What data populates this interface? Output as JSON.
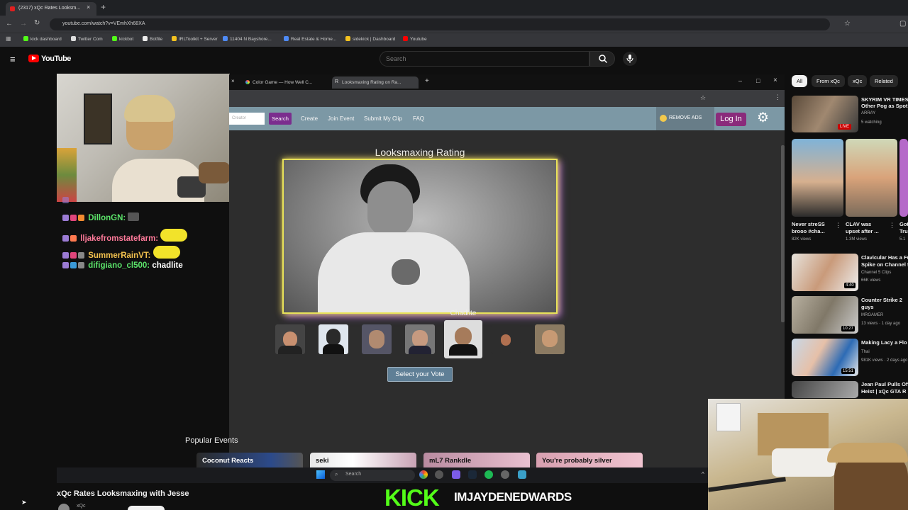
{
  "browser": {
    "tab_title": "(2317) xQc Rates Looksm...",
    "url": "youtube.com/watch?v=VEmhXh68XA",
    "bookmarks": [
      "kick dashboard",
      "Twitter Com",
      "kickbot",
      "Botfile",
      "IRLToolkit + Server",
      "11404 N Bayshore...",
      "Real Estate & Home...",
      "sidekick | Dashboard",
      "Youtube"
    ]
  },
  "youtube": {
    "logo": "YouTube",
    "search_placeholder": "Search",
    "video_title": "xQc Rates Looksmaxing with Jesse",
    "channel": "xQc"
  },
  "chat": [
    {
      "user": "DillonGN:",
      "msg": "",
      "color": "#5be36a"
    },
    {
      "user": "lljakefromstatefarm:",
      "msg": "",
      "color": "#ff7a9a"
    },
    {
      "user": "SummerRainVT:",
      "msg": "",
      "color": "#f2c14e"
    },
    {
      "user": "difigiano_cl500:",
      "msg": "chadlite",
      "color": "#5be36a"
    }
  ],
  "inner_browser": {
    "tabs": [
      "Color Game — How Well C...",
      "Looksmaxing Rating on Ra..."
    ]
  },
  "site": {
    "search_placeholder": "Creator",
    "search_button": "Search",
    "nav": [
      "Create",
      "Join Event",
      "Submit My Clip",
      "FAQ"
    ],
    "remove_ads": "REMOVE ADS",
    "login": "Log In",
    "rating_title": "Looksmaxing Rating",
    "photo_caption": "Chadlite",
    "vote_button": "Select your Vote",
    "popular_title": "Popular Events",
    "events": [
      "Coconut Reacts",
      "seki",
      "mL7 Rankdle",
      "You're probably silver"
    ]
  },
  "taskbar": {
    "search": "Search"
  },
  "chips": [
    "All",
    "From xQc",
    "xQc",
    "Related"
  ],
  "related": [
    {
      "title": "SKYRIM VR TIMES",
      "title2": "Other Pog as Spot",
      "channel": "ARRAY",
      "meta": "5 watching",
      "badge": "LIVE"
    },
    {
      "title": "Clavicular Has a Fu",
      "title2": "Spike on Channel 5",
      "channel": "Channel 5 Clips",
      "meta": "66K views",
      "badge": "4:40"
    },
    {
      "title": "Counter Strike 2",
      "title2": "guys",
      "channel": "MRGAMER",
      "meta": "13 views · 1 day ago",
      "badge": "10:27"
    },
    {
      "title": "Making Lacy a Flo",
      "title2": "",
      "channel": "Thai",
      "meta": "981K views · 2 days ago",
      "badge": "15:51"
    },
    {
      "title": "Jean Paul Pulls Off",
      "title2": "Heist | xQc GTA R",
      "channel": "",
      "meta": "",
      "badge": ""
    }
  ],
  "shorts": [
    {
      "title": "Never streSS",
      "title2": "brooo #cha...",
      "meta": "82K views"
    },
    {
      "title": "CLAV was",
      "title2": "upset after ...",
      "meta": "1.3M views"
    },
    {
      "title": "Got",
      "title2": "Tru",
      "meta": "5.1"
    }
  ],
  "overlay": {
    "kick_logo": "KICK",
    "kick_name": "IMJAYDENEDWARDS"
  },
  "colors": {
    "accent_youtube": "#ff0000",
    "kick_green": "#53fc18",
    "site_nav": "#7c98a5",
    "login": "#8a2b7b",
    "frame_glow": "#e8e25a"
  }
}
